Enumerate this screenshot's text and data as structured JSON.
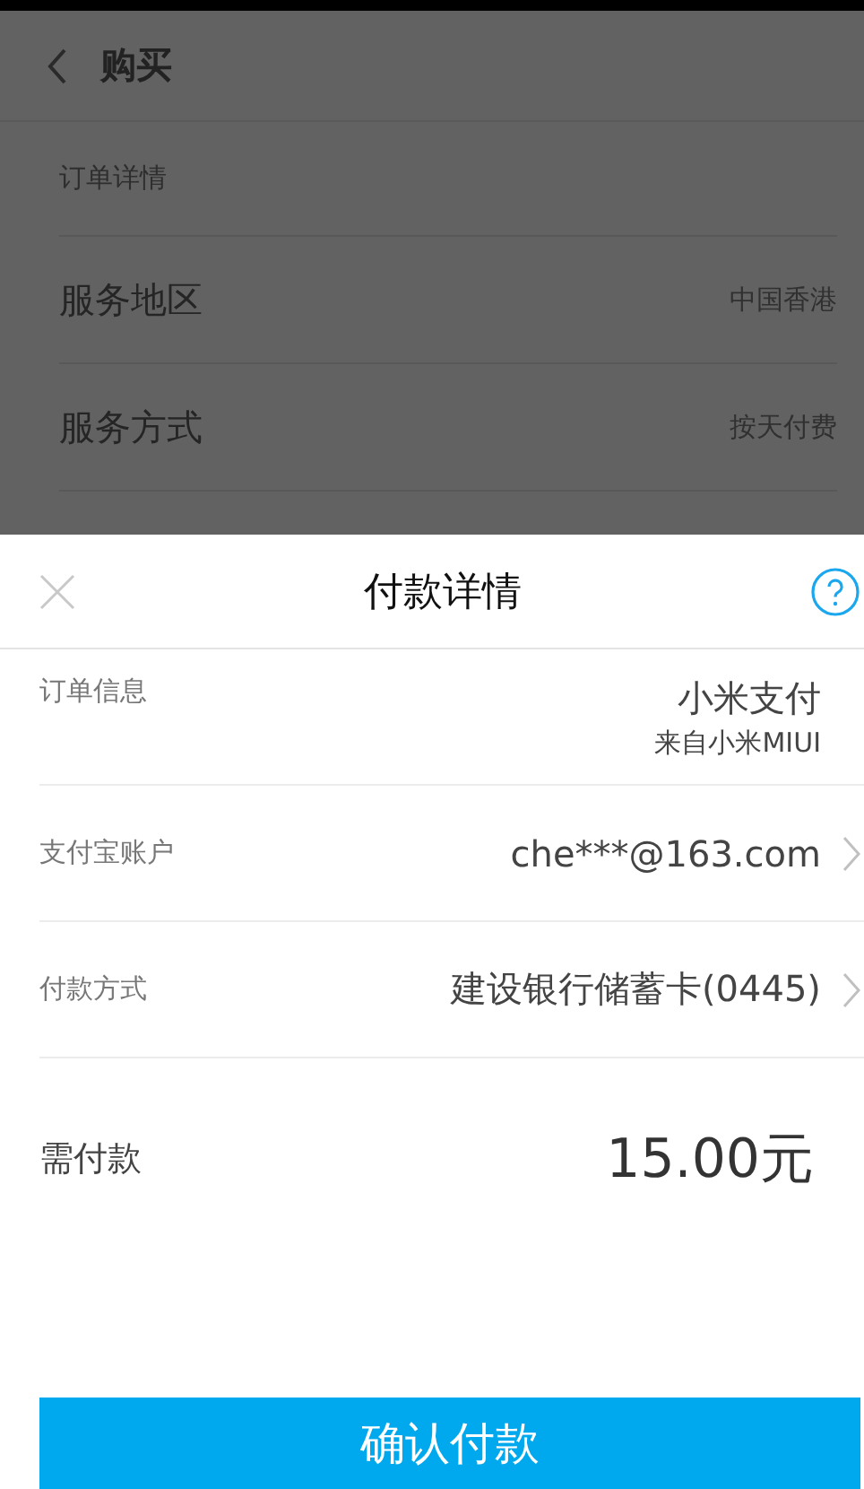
{
  "background_page": {
    "title": "购买",
    "section_label": "订单详情",
    "rows": [
      {
        "label": "服务地区",
        "value": "中国香港"
      },
      {
        "label": "服务方式",
        "value": "按天付费"
      }
    ]
  },
  "sheet": {
    "title": "付款详情",
    "rows": [
      {
        "kind": "info",
        "label": "订单信息",
        "value": "小米支付",
        "subvalue": "来自小米MIUI"
      },
      {
        "kind": "link",
        "label": "支付宝账户",
        "value": "che***@163.com"
      },
      {
        "kind": "link",
        "label": "付款方式",
        "value": "建设银行储蓄卡(0445)"
      }
    ],
    "amount": {
      "label": "需付款",
      "value": "15.00元"
    },
    "confirm_button": "确认付款"
  }
}
